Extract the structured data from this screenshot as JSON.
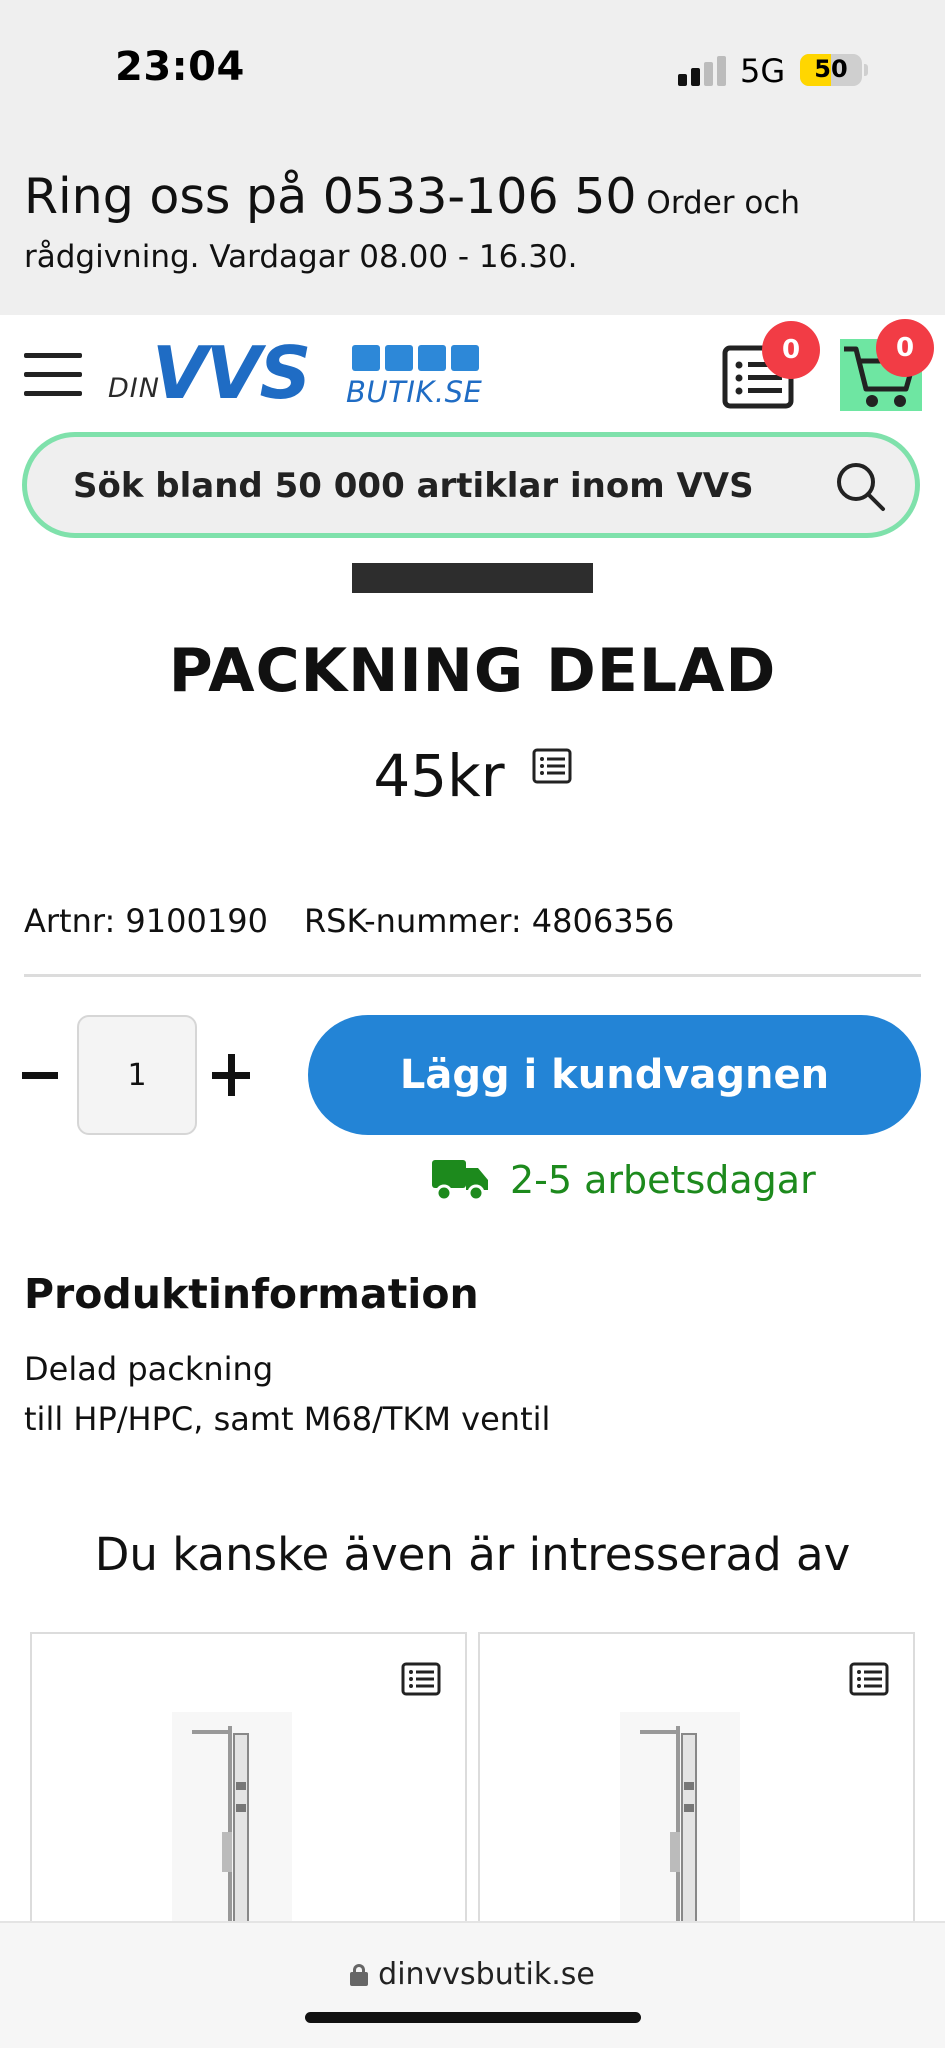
{
  "status_bar": {
    "time": "23:04",
    "network": "5G",
    "battery": "50",
    "battery_level": 0.5
  },
  "banner": {
    "call_prefix": "Ring oss på 0533-106 50",
    "call_suffix": " Order och",
    "hours": "rådgivning. Vardagar 08.00 - 16.30."
  },
  "header": {
    "logo_din": "DIN",
    "logo_vvs": "VVS",
    "logo_butik": "BUTIK.SE",
    "list_count": "0",
    "cart_count": "0"
  },
  "search": {
    "placeholder": "Sök bland 50 000 artiklar inom VVS"
  },
  "product": {
    "title": "PACKNING DELAD",
    "price": "45kr",
    "artnr": "Artnr: 9100190",
    "rsk": "RSK-nummer: 4806356",
    "quantity": "1",
    "add_to_cart": "Lägg i kundvagnen",
    "delivery": "2-5 arbetsdagar"
  },
  "info": {
    "heading": "Produktinformation",
    "line1": "Delad packning",
    "line2": "till HP/HPC, samt M68/TKM ventil"
  },
  "related": {
    "heading": "Du kanske även är intresserad av"
  },
  "browser": {
    "url": "dinvvsbutik.se"
  },
  "colors": {
    "accent_blue": "#2384d6",
    "badge_red": "#f23c45",
    "search_border": "#7fe1ab",
    "delivery_green": "#1d8a1d"
  }
}
